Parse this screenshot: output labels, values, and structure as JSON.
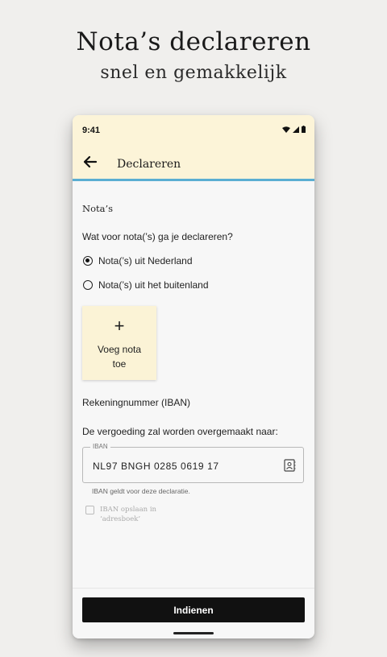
{
  "promo": {
    "title": "Nota’s declareren",
    "subtitle": "snel en gemakkelijk"
  },
  "status_bar": {
    "time": "9:41",
    "icons": [
      "wifi-icon",
      "signal-icon",
      "battery-icon"
    ]
  },
  "app_bar": {
    "back_icon": "arrow-left-icon",
    "title": "Declareren",
    "background": "#fcf4d8",
    "accent": "#5aaed2"
  },
  "notas": {
    "heading": "Nota’s",
    "question": "Wat voor nota(’s) ga je declareren?",
    "options": [
      {
        "label": "Nota(’s) uit Nederland",
        "selected": true
      },
      {
        "label": "Nota(’s) uit het buitenland",
        "selected": false
      }
    ],
    "add_button": {
      "icon": "plus-icon",
      "label_line1": "Voeg nota",
      "label_line2": "toe"
    }
  },
  "iban": {
    "heading": "Rekeningnummer (IBAN)",
    "question": "De vergoeding zal worden overgemaakt naar:",
    "field_label": "IBAN",
    "field_value": "NL97 BNGH 0285 0619 17",
    "field_icon": "contact-book-icon",
    "helper": "IBAN geldt voor deze declaratie.",
    "save_checkbox": {
      "checked": false,
      "label_line1": "IBAN opslaan in",
      "label_line2": "‘adresboek’"
    }
  },
  "footer": {
    "submit_label": "Indienen"
  }
}
